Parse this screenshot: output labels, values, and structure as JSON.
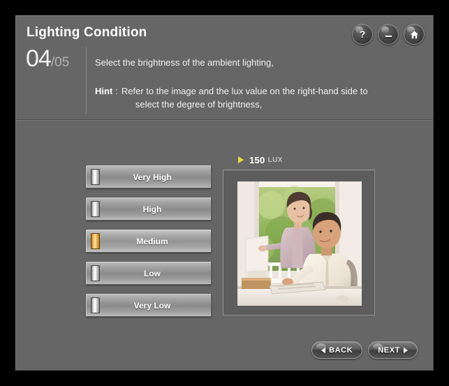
{
  "window": {
    "background_color": "#000000",
    "panel_color": "#666666"
  },
  "header": {
    "title": "Lighting Condition",
    "step_current": "04",
    "step_separator": "/",
    "step_total": "05",
    "instruction": "Select the brightness of the ambient lighting,",
    "hint_label": "Hint",
    "hint_colon": ":",
    "hint_line1": "Refer to the image and the lux value on the right-hand side to",
    "hint_line2": "select the degree of brightness,",
    "buttons": [
      {
        "name": "help-button",
        "glyph": "?"
      },
      {
        "name": "minimize-button",
        "glyph": "-"
      },
      {
        "name": "home-button",
        "glyph": "home"
      }
    ]
  },
  "options": {
    "items": [
      {
        "label": "Very High",
        "selected": false
      },
      {
        "label": "High",
        "selected": false
      },
      {
        "label": "Medium",
        "selected": true
      },
      {
        "label": "Low",
        "selected": false
      },
      {
        "label": "Very Low",
        "selected": false
      }
    ],
    "selected_label": "Medium",
    "selected_indicator_color": "#f0b840",
    "indicator_color": "#e8e8e8"
  },
  "preview": {
    "lux_value": "150",
    "lux_unit": "LUX",
    "lux_arrow_color": "#e8e03a",
    "image_description": "Woman standing pointing at a monitor beside a seated man typing at a keyboard in a bright sunlit room"
  },
  "footer": {
    "back_label": "BACK",
    "next_label": "NEXT"
  }
}
